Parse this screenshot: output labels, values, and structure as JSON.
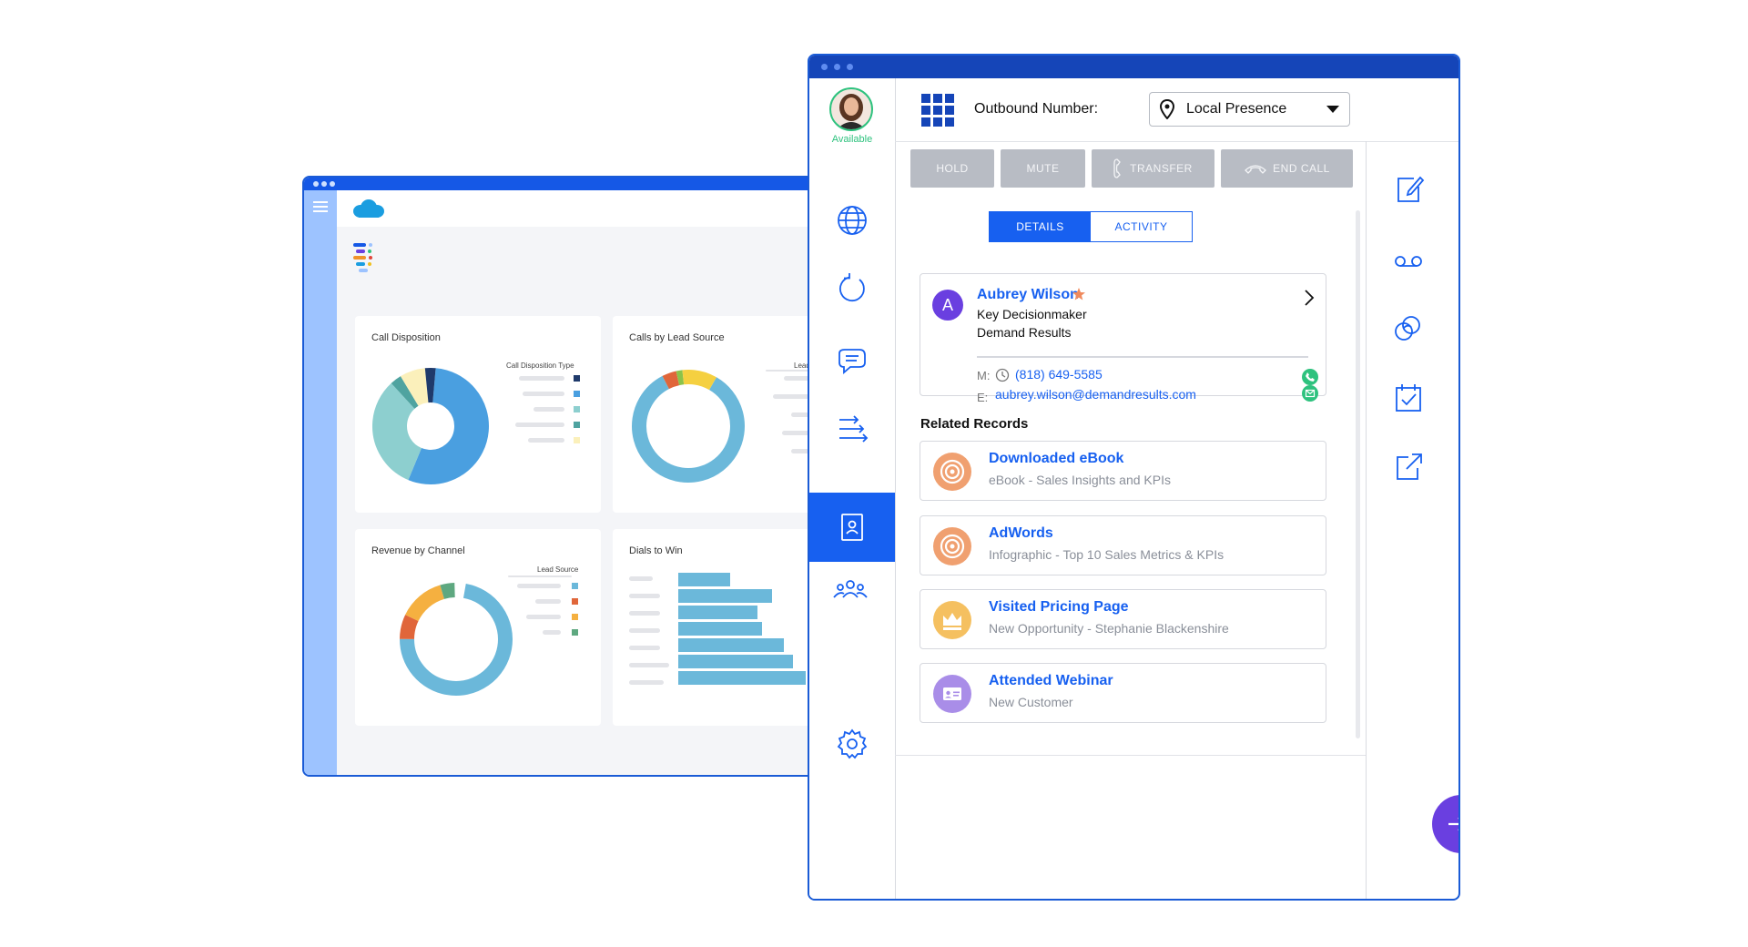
{
  "dashboard": {
    "panels": [
      {
        "title": "Call Disposition",
        "legend_title": "Call Disposition Type"
      },
      {
        "title": "Calls by Lead Source",
        "legend_title": "Lead"
      },
      {
        "title": "Revenue by Channel",
        "legend_title": "Lead Source"
      },
      {
        "title": "Dials to Win"
      }
    ],
    "colors": {
      "brand": "#1558e6",
      "cloud": "#1a9de0"
    }
  },
  "dialer": {
    "agent": {
      "status": "Available"
    },
    "outbound_label": "Outbound Number:",
    "outbound_value": "Local Presence",
    "buttons": {
      "hold": "HOLD",
      "mute": "MUTE",
      "transfer": "TRANSFER",
      "end_call": "END CALL"
    },
    "tabs": {
      "details": "DETAILS",
      "activity": "ACTIVITY"
    },
    "contact": {
      "initial": "A",
      "name": "Aubrey Wilson",
      "title": "Key Decisionmaker",
      "company": "Demand Results",
      "phone_label": "M:",
      "phone": "(818) 649-5585",
      "email_label": "E:",
      "email": "aubrey.wilson@demandresults.com"
    },
    "related_records_heading": "Related Records",
    "records": [
      {
        "title": "Downloaded eBook",
        "subtitle": "eBook - Sales Insights and KPIs",
        "icon": "target-icon"
      },
      {
        "title": "AdWords",
        "subtitle": "Infographic - Top 10 Sales Metrics & KPIs",
        "icon": "target-icon"
      },
      {
        "title": "Visited Pricing Page",
        "subtitle": "New Opportunity - Stephanie Blackenshire",
        "icon": "crown-icon"
      },
      {
        "title": "Attended Webinar",
        "subtitle": "New Customer",
        "icon": "id-card-icon"
      }
    ],
    "colors": {
      "accent": "#1760f0",
      "nav_active": "#1760f0",
      "fab": "#6a3fe0",
      "success": "#2ec27e"
    }
  }
}
